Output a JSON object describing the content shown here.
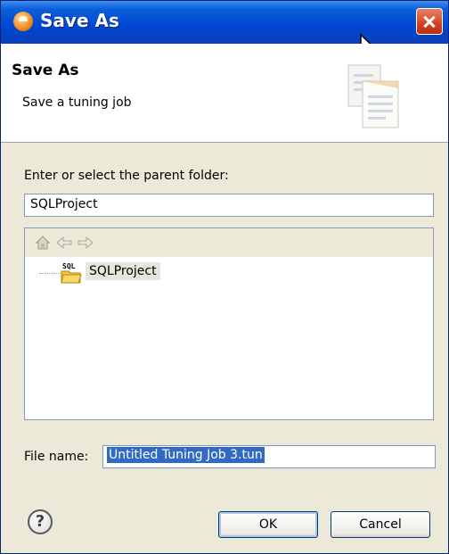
{
  "window": {
    "title": "Save As"
  },
  "header": {
    "title": "Save As",
    "subtitle": "Save a tuning job",
    "graphic_icon": "documents-icon"
  },
  "folder": {
    "label": "Enter or select the parent folder:",
    "value": "SQLProject"
  },
  "tree": {
    "toolbar": {
      "home_icon": "home-icon",
      "back_icon": "back-arrow-icon",
      "forward_icon": "forward-arrow-icon"
    },
    "items": [
      {
        "label": "SQLProject",
        "icon": "sql-project-folder-icon",
        "icon_text": "SQL"
      }
    ]
  },
  "file_name": {
    "label": "File name:",
    "value": "Untitled Tuning Job 3.tun"
  },
  "buttons": {
    "help_symbol": "?",
    "ok": "OK",
    "cancel": "Cancel"
  },
  "colors": {
    "titlebar": "#0046d5",
    "selection": "#316ac5",
    "dialog_bg": "#ece9d8"
  }
}
